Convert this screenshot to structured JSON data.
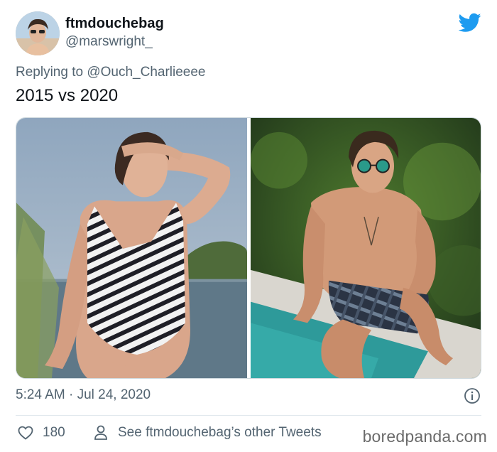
{
  "tweet": {
    "display_name": "ftmdouchebag",
    "handle": "@marswright_",
    "reply_prefix": "Replying to",
    "reply_to": "@Ouch_Charlieeee",
    "text": "2015 vs 2020",
    "timestamp": "5:24 AM · Jul 24, 2020",
    "like_count": "180",
    "other_tweets_label": "See ftmdouchebag’s other Tweets"
  },
  "watermark": "boredpanda.com",
  "colors": {
    "twitter_blue": "#1d9bf0",
    "secondary_text": "#536471",
    "primary_text": "#0f1419"
  },
  "icons": {
    "brand": "twitter-bird-icon",
    "info": "info-icon",
    "like": "heart-icon",
    "profile": "person-icon"
  }
}
